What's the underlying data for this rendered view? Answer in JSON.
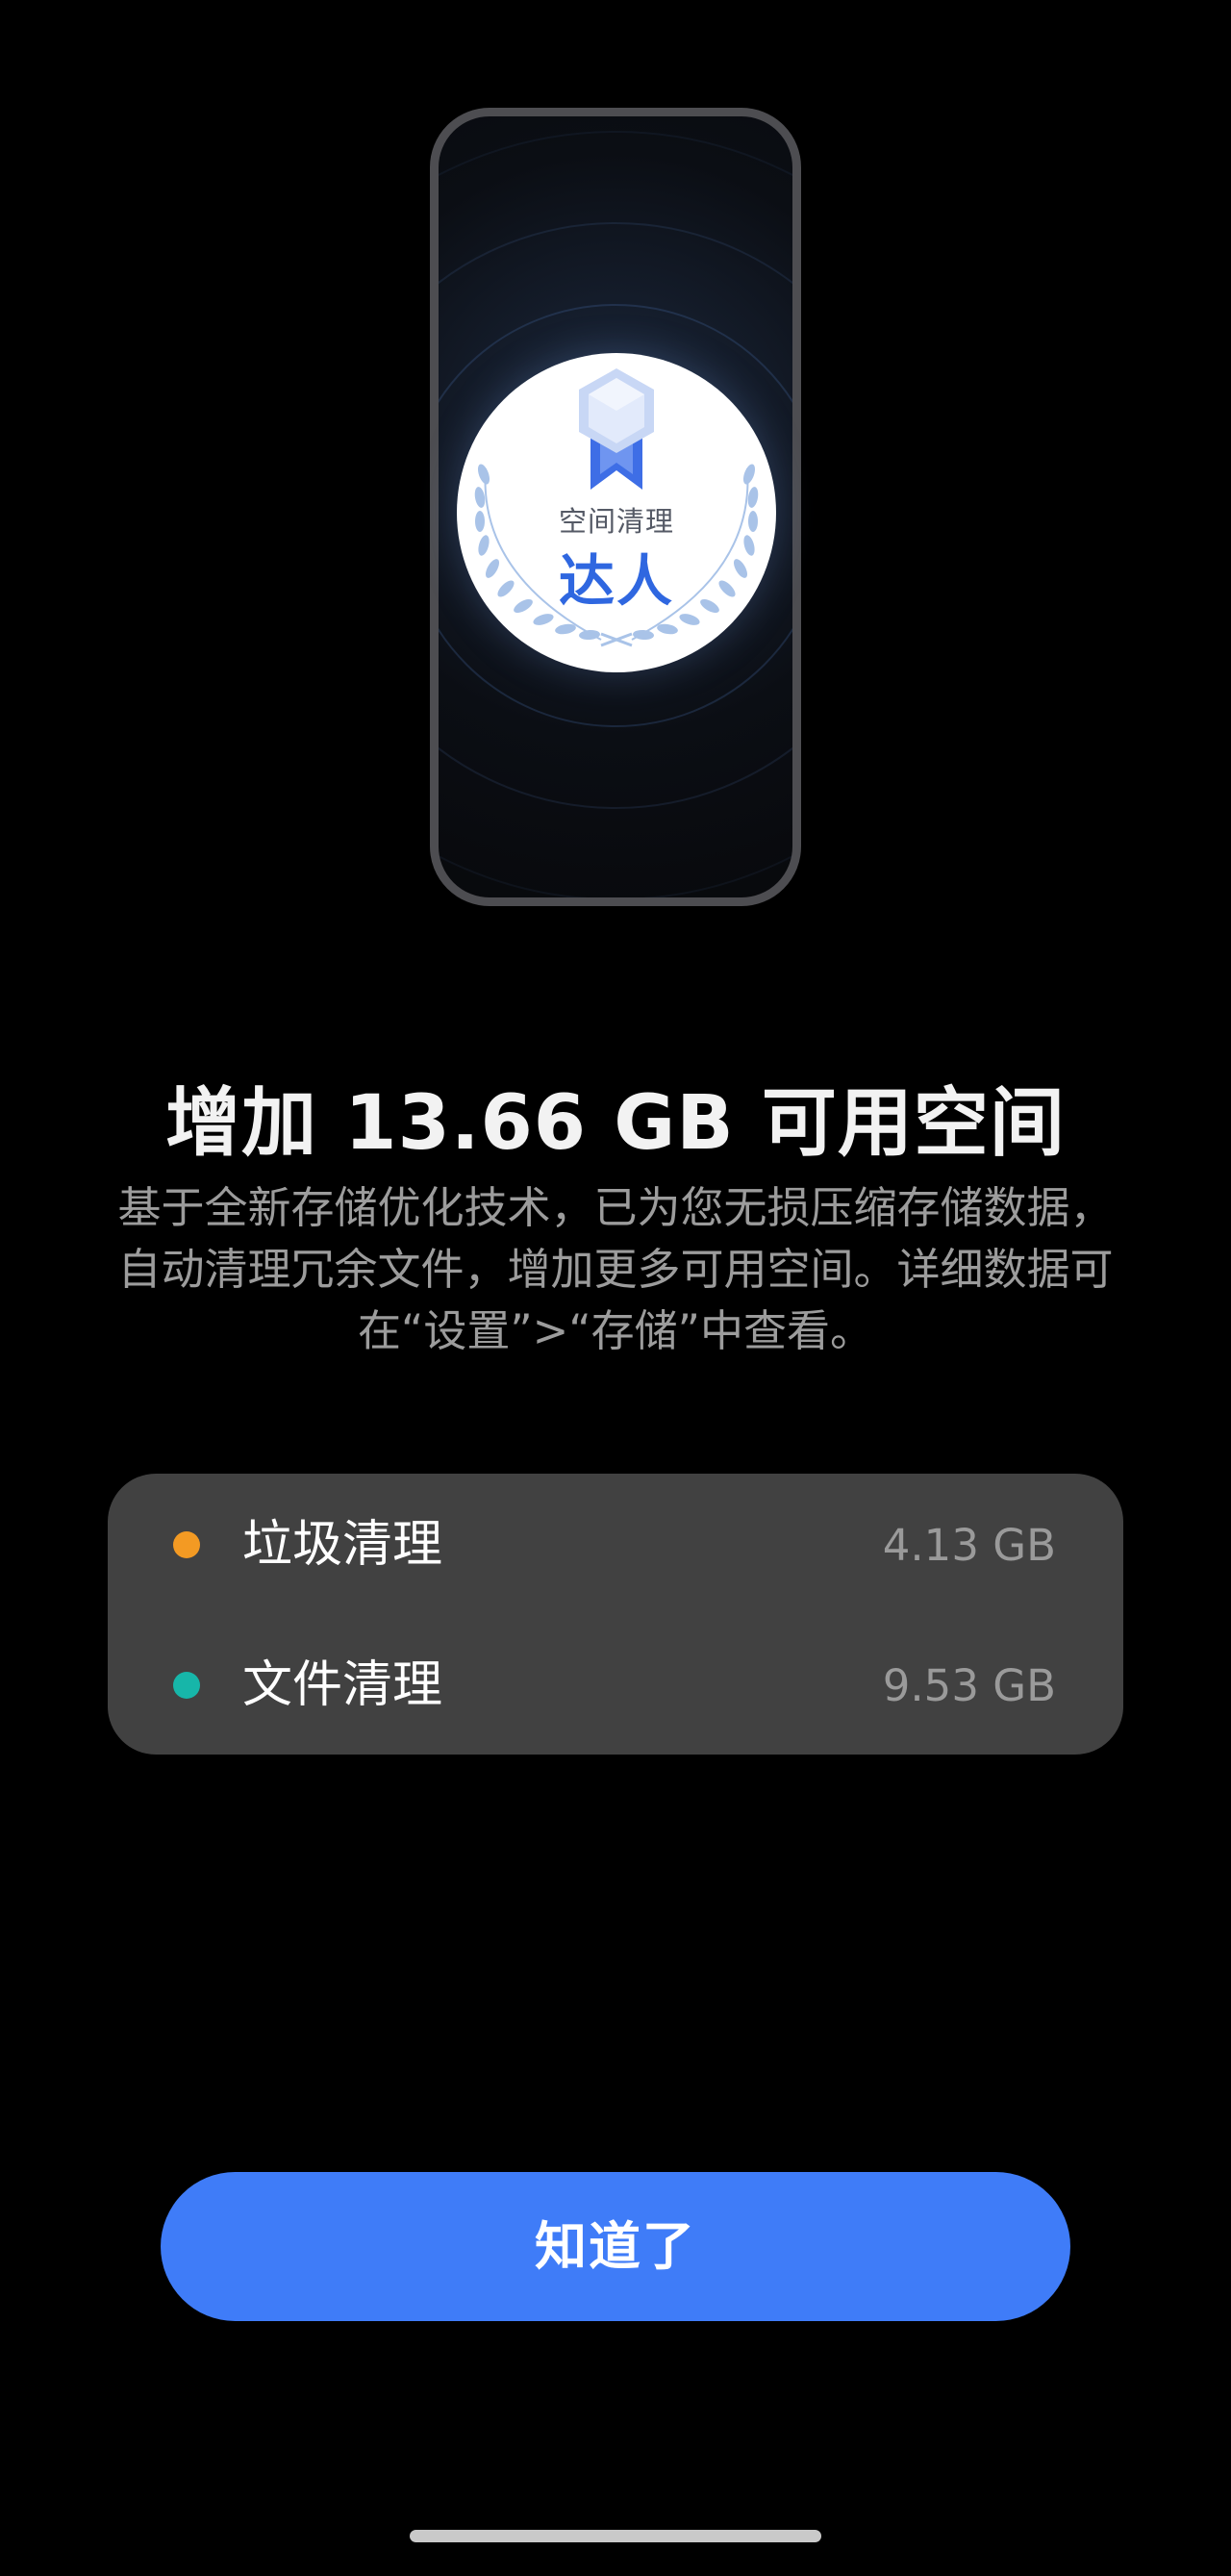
{
  "illustration": {
    "badge_title": "空间清理",
    "badge_main": "达人",
    "medal_icon": "medal-ribbon-icon",
    "colors": {
      "badge_text_primary": "#2f67e0",
      "medal_light": "#c8d7f5",
      "medal_ribbon": "#3e6ee6"
    }
  },
  "headline": "增加 13.66 GB 可用空间",
  "description": "基于全新存储优化技术，已为您无损压缩存储数据，自动清理冗余文件，增加更多可用空间。详细数据可在“设置”>“存储”中查看。",
  "stats": [
    {
      "label": "垃圾清理",
      "value": "4.13 GB",
      "dot_color": "#f39a23"
    },
    {
      "label": "文件清理",
      "value": "9.53 GB",
      "dot_color": "#17b6a9"
    }
  ],
  "confirm_button": "知道了",
  "colors": {
    "background": "#000000",
    "card": "#414141",
    "accent": "#3f7cf8"
  }
}
